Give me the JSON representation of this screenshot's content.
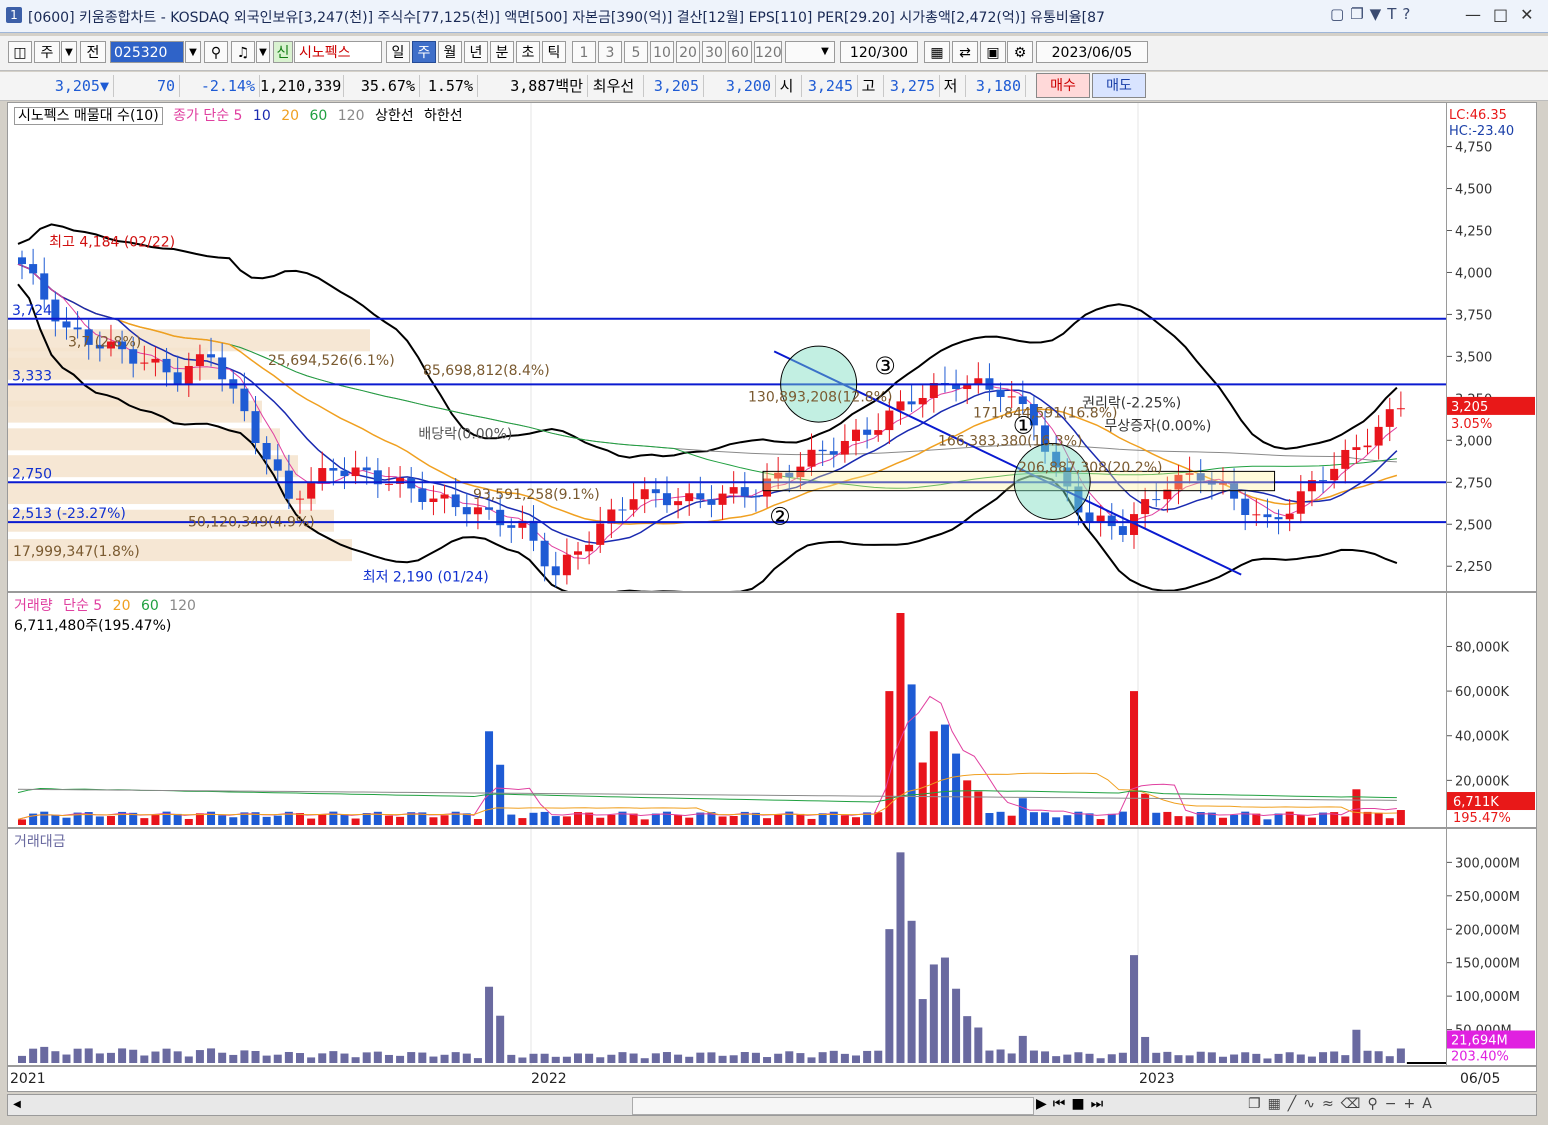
{
  "window": {
    "index": "1",
    "title": "[0600] 키움종합차트 - KOSDAQ 외국인보유[3,247(천)] 주식수[77,125(천)] 액면[500] 자본금[390(억)] 결산[12월] EPS[110] PER[29.20] 시가총액[2,472(억)] 유통비율[87",
    "icons": [
      "window-icon",
      "restore-icon",
      "pin-icon",
      "text-icon",
      "help-icon"
    ]
  },
  "toolbar": {
    "mode": "주",
    "prev": "전",
    "code": "025320",
    "sin_badge": "신",
    "stock_name": "시노펙스",
    "periods": [
      "일",
      "주",
      "월",
      "년",
      "분",
      "초",
      "틱"
    ],
    "active_period": "주",
    "intervals": [
      "1",
      "3",
      "5",
      "10",
      "20",
      "30",
      "60",
      "120"
    ],
    "bar_count": "120/300",
    "date": "2023/06/05"
  },
  "quote": {
    "price": "3,205▼",
    "change": "70",
    "change_pct": "-2.14%",
    "volume": "1,210,339",
    "vol_pct": "35.67%",
    "turnover": "1.57%",
    "amount": "3,887백만",
    "bid_label": "최우선",
    "ask": "3,205",
    "bid": "3,200",
    "open_label": "시",
    "open": "3,245",
    "high_label": "고",
    "high": "3,275",
    "low_label": "저",
    "low": "3,180",
    "buy_btn": "매수",
    "sell_btn": "매도"
  },
  "price_legend": {
    "name": "시노펙스 매물대 수(10)",
    "ma_label": "종가 단순 5",
    "ma10": "10",
    "ma20": "20",
    "ma60": "60",
    "ma120": "120",
    "upper": "상한선",
    "lower": "하한선"
  },
  "volume_legend": {
    "name": "거래량",
    "ma_label": "단순 5",
    "ma20": "20",
    "ma60": "60",
    "ma120": "120",
    "last": "6,711,480주(195.47%)"
  },
  "amount_legend": {
    "name": "거래대금"
  },
  "axis_right": {
    "lc": "LC:46.35",
    "hc": "HC:-23.40",
    "price_ticks": [
      "4,750",
      "4,500",
      "4,250",
      "4,000",
      "3,750",
      "3,500",
      "3,250",
      "3,000",
      "2,750",
      "2,500",
      "2,250"
    ],
    "current_price": "3,205",
    "current_pct": "3.05%",
    "volume_ticks": [
      "80,000K",
      "60,000K",
      "40,000K",
      "20,000K"
    ],
    "volume_current": "6,711K",
    "volume_pct": "195.47%",
    "amount_ticks": [
      "300,000M",
      "250,000M",
      "200,000M",
      "150,000M",
      "100,000M",
      "50,000M"
    ],
    "amount_current": "21,694M",
    "amount_pct": "203.40%"
  },
  "x_labels": [
    "2021",
    "2022",
    "2023",
    "06/05"
  ],
  "colors": {
    "up": "#e8141c",
    "down": "#1e5bd4",
    "hline": "#0a1ad0",
    "band": "#000000",
    "ma5": "#e040a0",
    "ma10": "#1a2ab0",
    "ma20": "#f0a020",
    "ma60": "#20a040",
    "ma120": "#8a8a8a",
    "amount": "#6a6aa0"
  },
  "chart_data": {
    "type": "candlestick",
    "period": "weekly",
    "x_range": [
      "2021-01",
      "2023-06-05"
    ],
    "ylim": [
      2150,
      4950
    ],
    "price_labels": {
      "high": "최고 4,184 (02/22)",
      "low": "최저 2,190 (01/24)",
      "hline_3333": "3,333",
      "hline_3724": "3,724",
      "hline_2750": "2,750",
      "hline_2513": "2,513 (-23.27%)"
    },
    "horizontal_lines": [
      3724,
      3333,
      2750,
      2513
    ],
    "volume_profile": [
      {
        "label": "25,694,526(6.1%)",
        "price": 3480
      },
      {
        "label": "85,698,812(8.4%)",
        "price": 3420
      },
      {
        "label": "130,893,208(12.8%)",
        "price": 3260
      },
      {
        "label": "171,844,591(16.8%)",
        "price": 3165
      },
      {
        "label": "166,383,380(16.3%)",
        "price": 3000
      },
      {
        "label": "206,887,308(20.2%)",
        "price": 2840
      },
      {
        "label": "93,591,258(9.1%)",
        "price": 2680
      },
      {
        "label": "50,120,349(4.9%)",
        "price": 2515
      },
      {
        "label": "17,999,347(1.8%)",
        "price": 2340
      },
      {
        "label": "3,7 (2.8%)",
        "price": 3590
      }
    ],
    "annotations": [
      "배당락(0.00%)",
      "권리락(-2.25%)",
      "무상증자(0.00%)",
      "①",
      "②",
      "③"
    ],
    "volume": {
      "ylim": [
        0,
        95000
      ],
      "spikes": [
        {
          "label": "2021-07",
          "value": 42000
        },
        {
          "label": "2022-05a",
          "value": 60000
        },
        {
          "label": "2022-05b",
          "value": 95000
        },
        {
          "label": "2022-06",
          "value": 63000
        },
        {
          "label": "2022-10",
          "value": 60000
        },
        {
          "label": "2023-06-05",
          "value": 6711
        }
      ]
    },
    "amount": {
      "ylim": [
        0,
        320000
      ],
      "peak_value": 315000,
      "last_value": 21694
    }
  }
}
